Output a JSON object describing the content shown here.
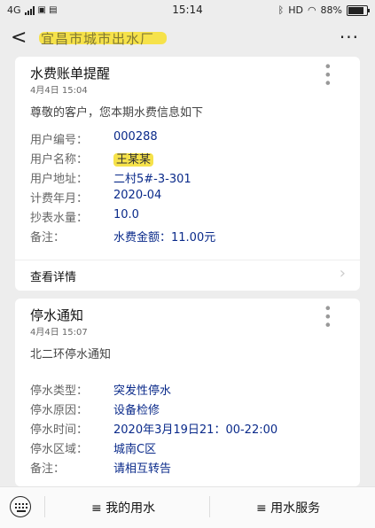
{
  "status_bar": {
    "network": "4G",
    "time": "15:14",
    "hd": "HD",
    "battery": "88%"
  },
  "nav": {
    "back_glyph": "<",
    "title": "宜昌市城市出水厂",
    "more_glyph": "···"
  },
  "cards": [
    {
      "title": "水费账单提醒",
      "time": "4月4日  15:04",
      "intro": "尊敬的客户，您本期水费信息如下",
      "fields": [
        {
          "label": "用户编号：",
          "value": "000288"
        },
        {
          "label": "用户名称：",
          "value": "王某某"
        },
        {
          "label": "用户地址：",
          "value": "二村5#-3-301"
        },
        {
          "label": "计费年月：",
          "value": "2020-04"
        },
        {
          "label": "抄表水量：",
          "value": "10.0"
        },
        {
          "label": "备注：",
          "value": "水费金额：11.00元"
        }
      ],
      "detail_label": "查看详情"
    },
    {
      "title": "停水通知",
      "time": "4月4日  15:07",
      "intro": "北二环停水通知",
      "fields": [
        {
          "label": "停水类型：",
          "value": "突发性停水"
        },
        {
          "label": "停水原因：",
          "value": "设备检修"
        },
        {
          "label": "停水时间：",
          "value": "2020年3月19日21：00-22:00"
        },
        {
          "label": "停水区域：",
          "value": "城南C区"
        },
        {
          "label": "备注：",
          "value": "请相互转告"
        }
      ]
    }
  ],
  "bottom_menu": {
    "item1": "≡ 我的用水",
    "item2": "≡ 用水服务"
  }
}
